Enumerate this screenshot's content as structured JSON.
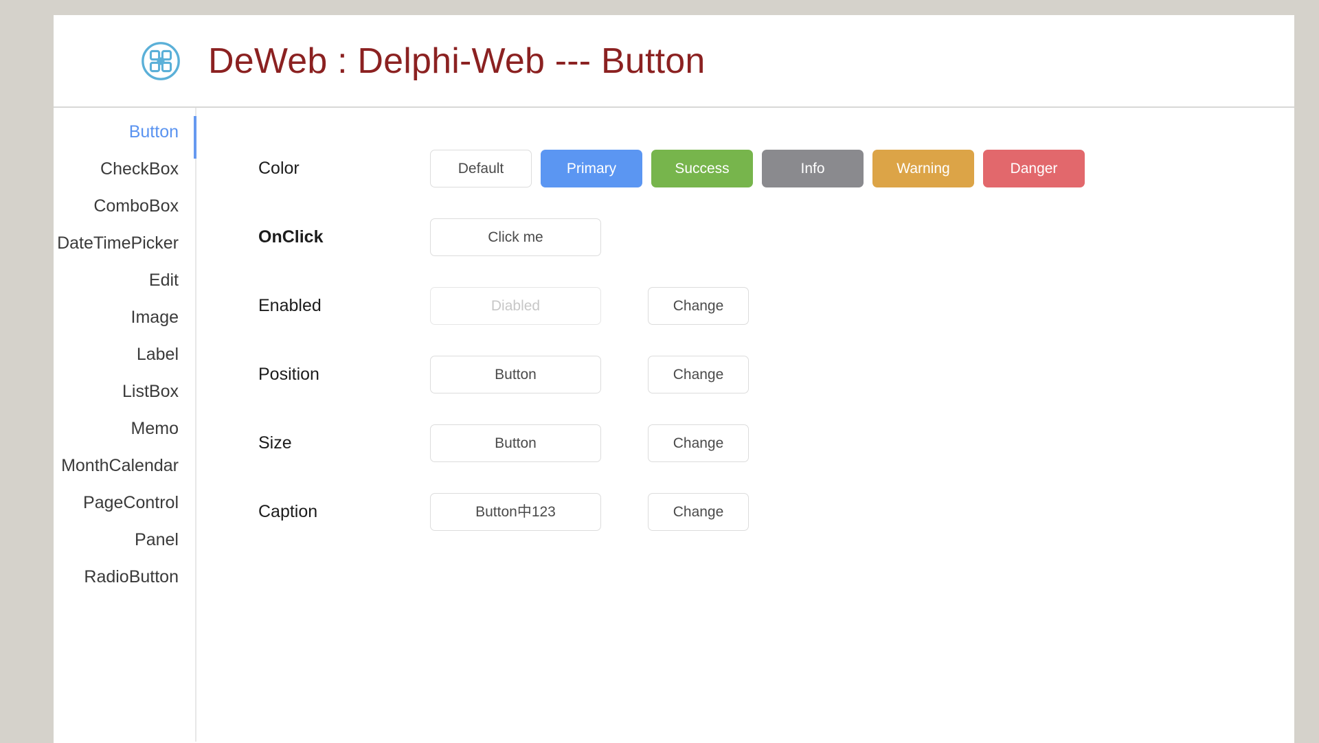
{
  "window": {
    "background_color": "#d5d2cb",
    "card_background": "#ffffff"
  },
  "header": {
    "logo_icon": "app-grid-circle-icon",
    "title": "DeWeb : Delphi-Web --- Button",
    "title_color": "#8b2121"
  },
  "sidebar": {
    "active_index": 0,
    "active_color": "#5a93f0",
    "items": [
      {
        "label": "Button"
      },
      {
        "label": "CheckBox"
      },
      {
        "label": "ComboBox"
      },
      {
        "label": "DateTimePicker"
      },
      {
        "label": "Edit"
      },
      {
        "label": "Image"
      },
      {
        "label": "Label"
      },
      {
        "label": "ListBox"
      },
      {
        "label": "Memo"
      },
      {
        "label": "MonthCalendar"
      },
      {
        "label": "PageControl"
      },
      {
        "label": "Panel"
      },
      {
        "label": "RadioButton"
      }
    ]
  },
  "main": {
    "rows": [
      {
        "label": "Color",
        "label_bold": false,
        "type": "color-swatches",
        "buttons": [
          {
            "label": "Default",
            "color": "#ffffff",
            "text_color": "#4a4a4a",
            "style": "default"
          },
          {
            "label": "Primary",
            "color": "#5b96f2",
            "text_color": "#ffffff",
            "style": "colored"
          },
          {
            "label": "Success",
            "color": "#77b54c",
            "text_color": "#ffffff",
            "style": "colored"
          },
          {
            "label": "Info",
            "color": "#8a8a8e",
            "text_color": "#ffffff",
            "style": "colored"
          },
          {
            "label": "Warning",
            "color": "#dca447",
            "text_color": "#ffffff",
            "style": "colored"
          },
          {
            "label": "Danger",
            "color": "#e2686c",
            "text_color": "#ffffff",
            "style": "colored"
          }
        ]
      },
      {
        "label": "OnClick",
        "label_bold": true,
        "type": "value-only",
        "value_label": "Click me",
        "value_disabled": false,
        "change_label": null
      },
      {
        "label": "Enabled",
        "label_bold": false,
        "type": "value-change",
        "value_label": "Diabled",
        "value_disabled": true,
        "change_label": "Change"
      },
      {
        "label": "Position",
        "label_bold": false,
        "type": "value-change",
        "value_label": "Button",
        "value_disabled": false,
        "change_label": "Change"
      },
      {
        "label": "Size",
        "label_bold": false,
        "type": "value-change",
        "value_label": "Button",
        "value_disabled": false,
        "change_label": "Change"
      },
      {
        "label": "Caption",
        "label_bold": false,
        "type": "value-change",
        "value_label": "Button中123",
        "value_disabled": false,
        "change_label": "Change"
      }
    ]
  }
}
